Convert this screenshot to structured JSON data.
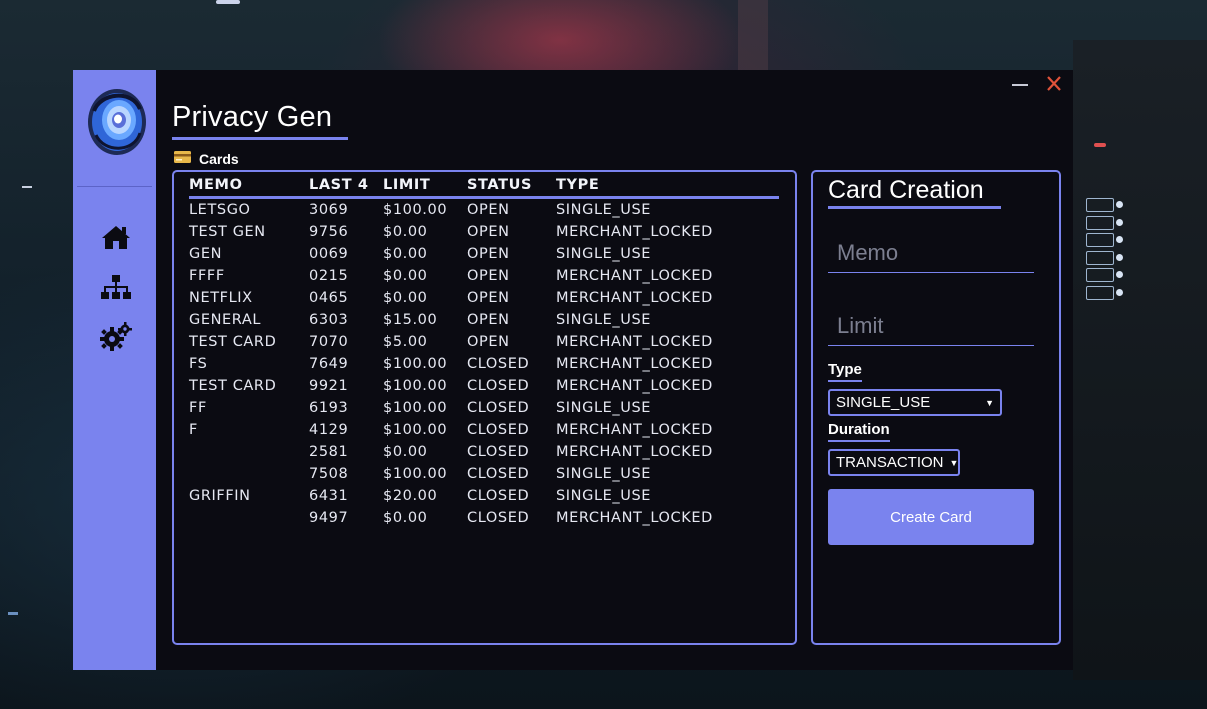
{
  "app": {
    "title": "Privacy Gen"
  },
  "window_controls": {
    "minimize_icon": "minimize-icon",
    "close_icon": "close-icon",
    "close_color": "#e0523a"
  },
  "sidebar": {
    "background": "#7a83ee",
    "nav": [
      {
        "icon": "home-icon"
      },
      {
        "icon": "sitemap-icon"
      },
      {
        "icon": "gears-icon"
      }
    ]
  },
  "cards_section": {
    "label": "Cards",
    "icon": "credit-card-icon",
    "columns": [
      "MEMO",
      "LAST 4",
      "LIMIT",
      "STATUS",
      "TYPE"
    ],
    "rows": [
      [
        "LETSGO",
        "3069",
        "$100.00",
        "OPEN",
        "SINGLE_USE"
      ],
      [
        "TEST GEN",
        "9756",
        "$0.00",
        "OPEN",
        "MERCHANT_LOCKED"
      ],
      [
        "GEN",
        "0069",
        "$0.00",
        "OPEN",
        "SINGLE_USE"
      ],
      [
        "FFFF",
        "0215",
        "$0.00",
        "OPEN",
        "MERCHANT_LOCKED"
      ],
      [
        "NETFLIX",
        "0465",
        "$0.00",
        "OPEN",
        "MERCHANT_LOCKED"
      ],
      [
        "GENERAL",
        "6303",
        "$15.00",
        "OPEN",
        "SINGLE_USE"
      ],
      [
        "TEST CARD",
        "7070",
        "$5.00",
        "OPEN",
        "MERCHANT_LOCKED"
      ],
      [
        "FS",
        "7649",
        "$100.00",
        "CLOSED",
        "MERCHANT_LOCKED"
      ],
      [
        "TEST CARD",
        "9921",
        "$100.00",
        "CLOSED",
        "MERCHANT_LOCKED"
      ],
      [
        "FF",
        "6193",
        "$100.00",
        "CLOSED",
        "SINGLE_USE"
      ],
      [
        "F",
        "4129",
        "$100.00",
        "CLOSED",
        "MERCHANT_LOCKED"
      ],
      [
        "",
        "2581",
        "$0.00",
        "CLOSED",
        "MERCHANT_LOCKED"
      ],
      [
        "",
        "7508",
        "$100.00",
        "CLOSED",
        "SINGLE_USE"
      ],
      [
        "GRIFFIN",
        "6431",
        "$20.00",
        "CLOSED",
        "SINGLE_USE"
      ],
      [
        "",
        "9497",
        "$0.00",
        "CLOSED",
        "MERCHANT_LOCKED"
      ]
    ]
  },
  "card_creation": {
    "title": "Card Creation",
    "memo_placeholder": "Memo",
    "limit_placeholder": "Limit",
    "type_label": "Type",
    "type_value": "SINGLE_USE",
    "duration_label": "Duration",
    "duration_value": "TRANSACTION",
    "create_button": "Create Card"
  },
  "colors": {
    "accent": "#7a83ee",
    "panel_bg": "#0b0b12",
    "text": "#e6e8f2"
  }
}
